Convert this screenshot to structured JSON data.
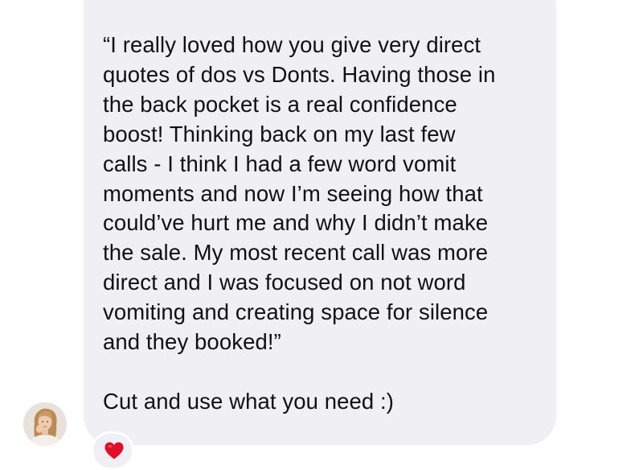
{
  "message": {
    "lines": [
      "“I really loved how you give very direct",
      "quotes of dos vs Donts. Having those in",
      "the back pocket is a real confidence",
      "boost! Thinking back on my last few",
      "calls - I think I had a few word vomit",
      "moments and now I’m seeing how that",
      "could’ve hurt me and why I didn’t make",
      "the sale. My most recent call was more",
      "direct and I was focused on not word",
      "vomiting and creating space for silence",
      "and they booked!”"
    ],
    "closing": "Cut and use what you need :)"
  },
  "reaction": {
    "icon": "heart-icon",
    "color": "#e0102b"
  },
  "sender": {
    "avatar_icon": "avatar"
  },
  "colors": {
    "bubble": "#efeff4",
    "text": "#111111",
    "background": "#ffffff"
  }
}
